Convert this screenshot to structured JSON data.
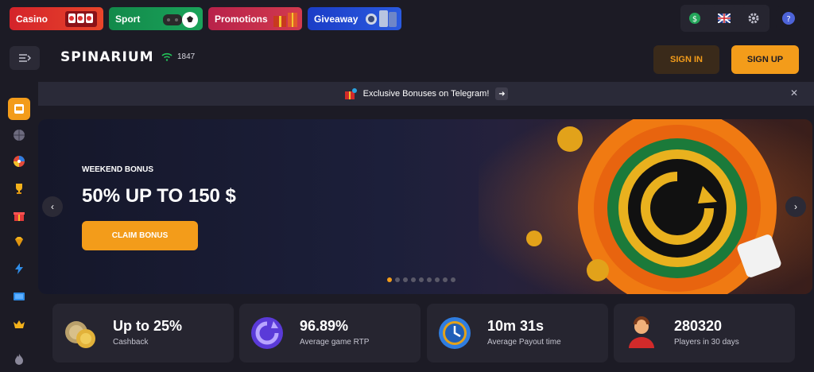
{
  "categories": [
    {
      "label": "Casino",
      "icon": "slot-machine-icon"
    },
    {
      "label": "Sport",
      "icon": "soccer-ball-icon"
    },
    {
      "label": "Promotions",
      "icon": "gift-box-icon"
    },
    {
      "label": "Giveaway",
      "icon": "phone-watch-icon"
    }
  ],
  "header": {
    "logo": "SPINARIUM",
    "online_count": "1847",
    "sign_in": "SIGN IN",
    "sign_up": "SIGN UP"
  },
  "telegram": {
    "text": "Exclusive Bonuses on Telegram!"
  },
  "banner": {
    "eyebrow": "WEEKEND BONUS",
    "headline": "50% UP TO 150 $",
    "button": "CLAIM BONUS",
    "slides": 9,
    "active_slide": 1
  },
  "stats": [
    {
      "value": "Up to 25%",
      "label": "Cashback",
      "icon": "coins-icon"
    },
    {
      "value": "96.89%",
      "label": "Average game RTP",
      "icon": "refresh-icon"
    },
    {
      "value": "10m 31s",
      "label": "Average Payout time",
      "icon": "clock-icon"
    },
    {
      "value": "280320",
      "label": "Players in 30 days",
      "icon": "user-icon"
    }
  ],
  "colors": {
    "accent": "#f39c1a",
    "background": "#1c1b25",
    "card": "#262530"
  }
}
